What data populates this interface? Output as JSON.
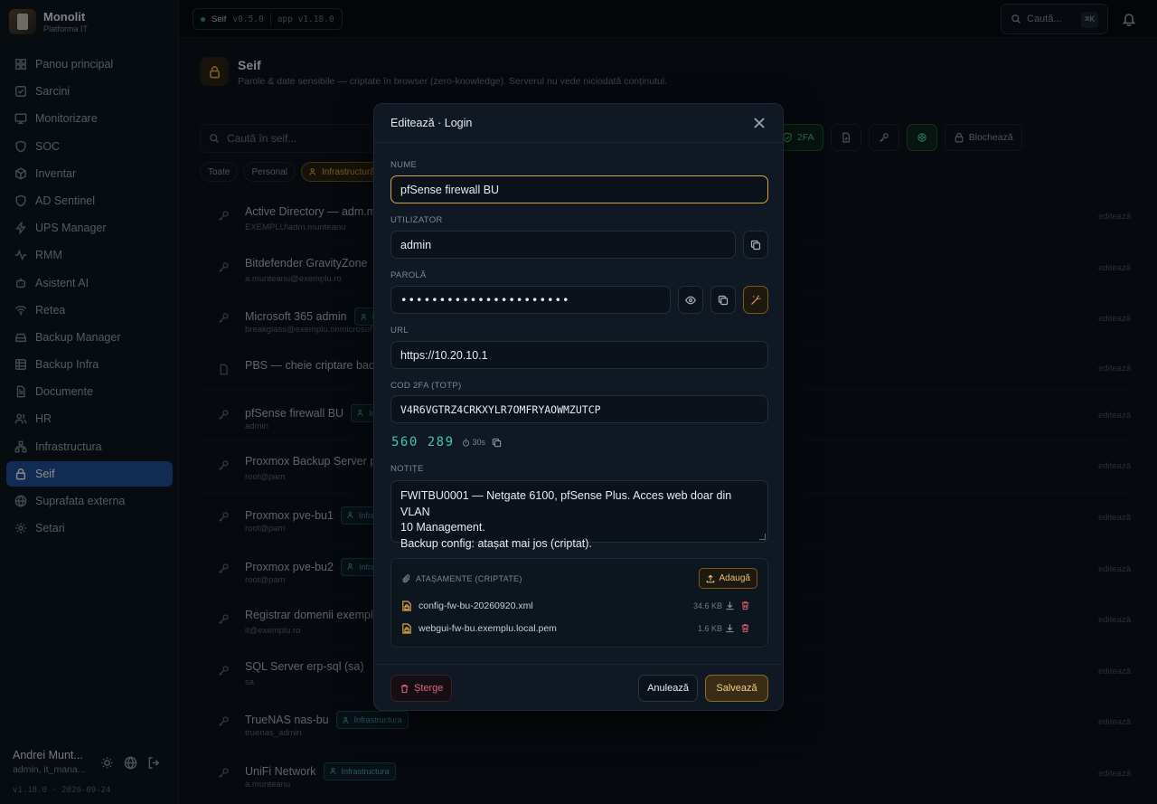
{
  "brand": {
    "title": "Monolit",
    "subtitle": "Platforma IT"
  },
  "sidebar": {
    "items": [
      {
        "label": "Panou principal",
        "icon": "grid-icon"
      },
      {
        "label": "Sarcini",
        "icon": "checkbox-icon"
      },
      {
        "label": "Monitorizare",
        "icon": "monitor-icon"
      },
      {
        "label": "SOC",
        "icon": "shield-icon"
      },
      {
        "label": "Inventar",
        "icon": "box-icon"
      },
      {
        "label": "AD Sentinel",
        "icon": "shield-icon"
      },
      {
        "label": "UPS Manager",
        "icon": "bolt-icon"
      },
      {
        "label": "RMM",
        "icon": "activity-icon"
      },
      {
        "label": "Asistent AI",
        "icon": "sparkle-icon"
      },
      {
        "label": "Retea",
        "icon": "wifi-icon"
      },
      {
        "label": "Backup Manager",
        "icon": "drive-icon"
      },
      {
        "label": "Backup Infra",
        "icon": "database-icon"
      },
      {
        "label": "Documente",
        "icon": "document-icon"
      },
      {
        "label": "HR",
        "icon": "users-icon"
      },
      {
        "label": "Infrastructura",
        "icon": "network-icon"
      },
      {
        "label": "Seif",
        "icon": "lock-icon",
        "active": true
      },
      {
        "label": "Suprafata externa",
        "icon": "globe-icon"
      },
      {
        "label": "Setari",
        "icon": "gear-icon"
      }
    ]
  },
  "user": {
    "name": "Andrei Munt...",
    "role": "admin, it_mana...",
    "version": "v1.18.0 · 2026-09-24"
  },
  "topbar": {
    "app_name": "Seif",
    "module_version": "v0.5.0",
    "app_version": "app v1.18.0",
    "search_placeholder": "Caută...",
    "shortcut": "⌘K",
    "status_color": "#2ea36b"
  },
  "page": {
    "title": "Seif",
    "subtitle": "Parole & date sensibile — criptate în browser (zero-knowledge). Serverul nu vede niciodată conținutul.",
    "search_placeholder": "Caută în seif...",
    "filters": [
      "Toate",
      "Personal",
      "Infrastructură"
    ],
    "toolbar": {
      "twofa_label": "2FA",
      "lock_label": "Blochează"
    }
  },
  "entries": [
    {
      "title": "Active Directory — adm.m",
      "sub": "EXEMPLU\\adm.munteanu",
      "tag": "",
      "type": "key"
    },
    {
      "title": "Bitdefender GravityZone",
      "sub": "a.munteanu@exemplu.ro",
      "tag": "",
      "type": "key"
    },
    {
      "title": "Microsoft 365 admin",
      "sub": "breakglass@exemplu.onmicrosof",
      "tag": "In",
      "type": "key"
    },
    {
      "title": "PBS — cheie criptare back",
      "sub": "",
      "tag": "",
      "type": "doc"
    },
    {
      "title": "pfSense firewall BU",
      "sub": "admin",
      "tag": "Infr",
      "type": "key"
    },
    {
      "title": "Proxmox Backup Server pl",
      "sub": "root@pam",
      "tag": "",
      "type": "key"
    },
    {
      "title": "Proxmox pve-bu1",
      "sub": "root@pam",
      "tag": "Infras",
      "type": "key"
    },
    {
      "title": "Proxmox pve-bu2",
      "sub": "root@pam",
      "tag": "Infras",
      "type": "key"
    },
    {
      "title": "Registrar domenii exempl",
      "sub": "it@exemplu.ro",
      "tag": "",
      "type": "key"
    },
    {
      "title": "SQL Server erp-sql (sa)",
      "sub": "sa",
      "tag": "",
      "type": "key"
    },
    {
      "title": "TrueNAS nas-bu",
      "sub": "truenas_admin",
      "tag": "Infrastructura",
      "type": "key"
    },
    {
      "title": "UniFi Network",
      "sub": "a.munteanu",
      "tag": "Infrastructura",
      "type": "key"
    }
  ],
  "edit_label": "editează",
  "modal": {
    "title": "Editează · Login",
    "name_label": "NUME",
    "name_value": "pfSense firewall BU",
    "user_label": "UTILIZATOR",
    "user_value": "admin",
    "password_label": "PAROLĂ",
    "password_value": "••••••••••••••••••••••",
    "url_label": "URL",
    "url_value": "https://10.20.10.1",
    "totp_label": "COD 2FA (TOTP)",
    "totp_secret": "V4R6VGTRZ4CRKXYLR7OMFRYAOWMZUTCP",
    "totp_code": "560 289",
    "totp_timer": "30s",
    "notes_label": "NOTIȚE",
    "notes_lines": [
      "FWITBU0001 — Netgate 6100, pfSense Plus. Acces web doar din VLAN",
      "10 Management.",
      "Backup config: atașat mai jos (criptat)."
    ],
    "attachments_label": "ATAȘAMENTE (CRIPTATE)",
    "add_label": "Adaugă",
    "attachments": [
      {
        "name": "config-fw-bu-20260920.xml",
        "size": "34.6 KB"
      },
      {
        "name": "webgui-fw-bu.exemplu.local.pem",
        "size": "1.6 KB"
      }
    ],
    "delete_label": "Șterge",
    "cancel_label": "Anulează",
    "save_label": "Salvează",
    "accent_color": "#d9a441"
  }
}
